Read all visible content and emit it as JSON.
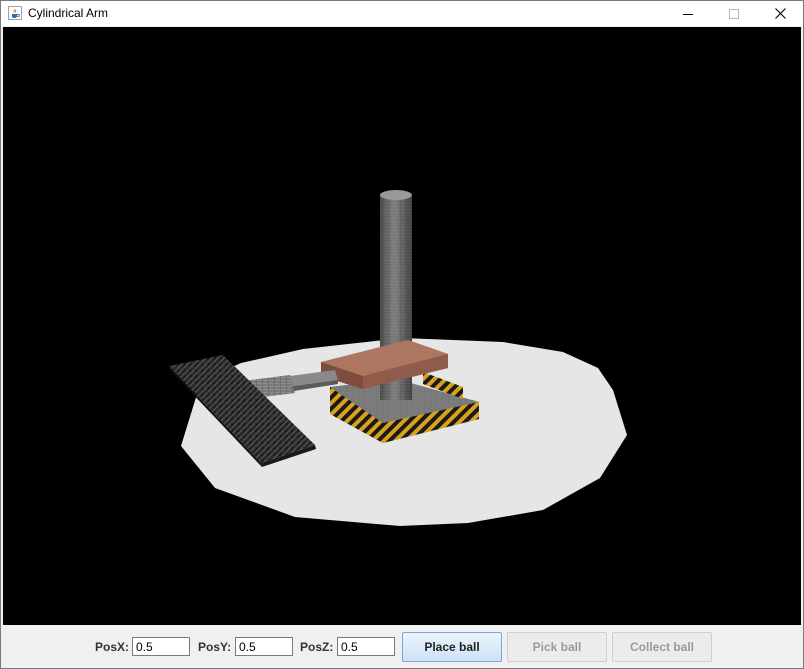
{
  "window": {
    "title": "Cylindrical Arm",
    "app_icon": "java-cup-icon",
    "controls": {
      "minimize_icon": "minimize-icon",
      "maximize_icon": "maximize-icon",
      "close_icon": "close-icon"
    }
  },
  "scene": {
    "background_color": "#000000",
    "platform_color": "#e8e8e8",
    "objects": [
      "platform",
      "base",
      "column",
      "carriage",
      "arm",
      "gripper"
    ]
  },
  "controls": {
    "posx": {
      "label": "PosX:",
      "value": "0.5"
    },
    "posy": {
      "label": "PosY:",
      "value": "0.5"
    },
    "posz": {
      "label": "PosZ:",
      "value": "0.5"
    },
    "place_ball": {
      "label": "Place ball",
      "enabled": true
    },
    "pick_ball": {
      "label": "Pick ball",
      "enabled": false
    },
    "collect_ball": {
      "label": "Collect ball",
      "enabled": false
    }
  }
}
